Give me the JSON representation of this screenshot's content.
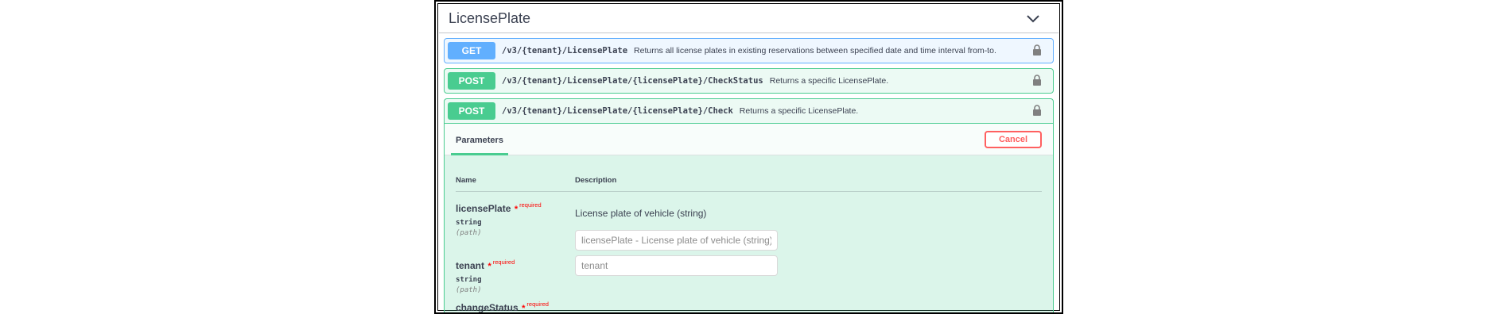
{
  "section": {
    "title": "LicensePlate"
  },
  "operations": [
    {
      "method": "GET",
      "path": "/v3/{tenant}/LicensePlate",
      "description": "Returns all license plates in existing reservations between specified date and time interval from-to."
    },
    {
      "method": "POST",
      "path": "/v3/{tenant}/LicensePlate/{licensePlate}/CheckStatus",
      "description": "Returns a specific LicensePlate."
    },
    {
      "method": "POST",
      "path": "/v3/{tenant}/LicensePlate/{licensePlate}/Check",
      "description": "Returns a specific LicensePlate."
    }
  ],
  "expanded": {
    "tab_label": "Parameters",
    "cancel_label": "Cancel",
    "columns": {
      "name": "Name",
      "description": "Description"
    },
    "params": [
      {
        "name": "licensePlate",
        "star": "*",
        "required": "required",
        "type": "string",
        "in": "(path)",
        "description": "License plate of vehicle (string)",
        "placeholder": "licensePlate - License plate of vehicle (string)"
      },
      {
        "name": "tenant",
        "star": "*",
        "required": "required",
        "type": "string",
        "in": "(path)",
        "placeholder": "tenant"
      },
      {
        "name": "changeStatus",
        "star": "*",
        "required": "required"
      }
    ]
  },
  "colors": {
    "get": "#61affe",
    "post": "#49cc90",
    "cancel": "#ff6060",
    "required": "#ff0000"
  },
  "icons": {
    "collapse": "chevron-down-icon",
    "lock": "lock-icon"
  }
}
